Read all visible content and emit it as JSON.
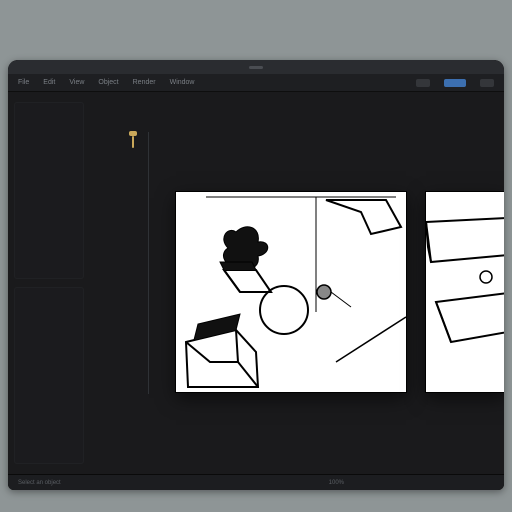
{
  "menubar": {
    "items": [
      "File",
      "Edit",
      "View",
      "Object",
      "Render",
      "Window"
    ]
  },
  "statusbar": {
    "hint": "Select an object",
    "zoom": "100%"
  },
  "colors": {
    "accent": "#3c6fb0",
    "bg_dark": "#1a1a1c",
    "canvas": "#ffffff"
  },
  "icons": {
    "playhead": "playhead-icon"
  }
}
